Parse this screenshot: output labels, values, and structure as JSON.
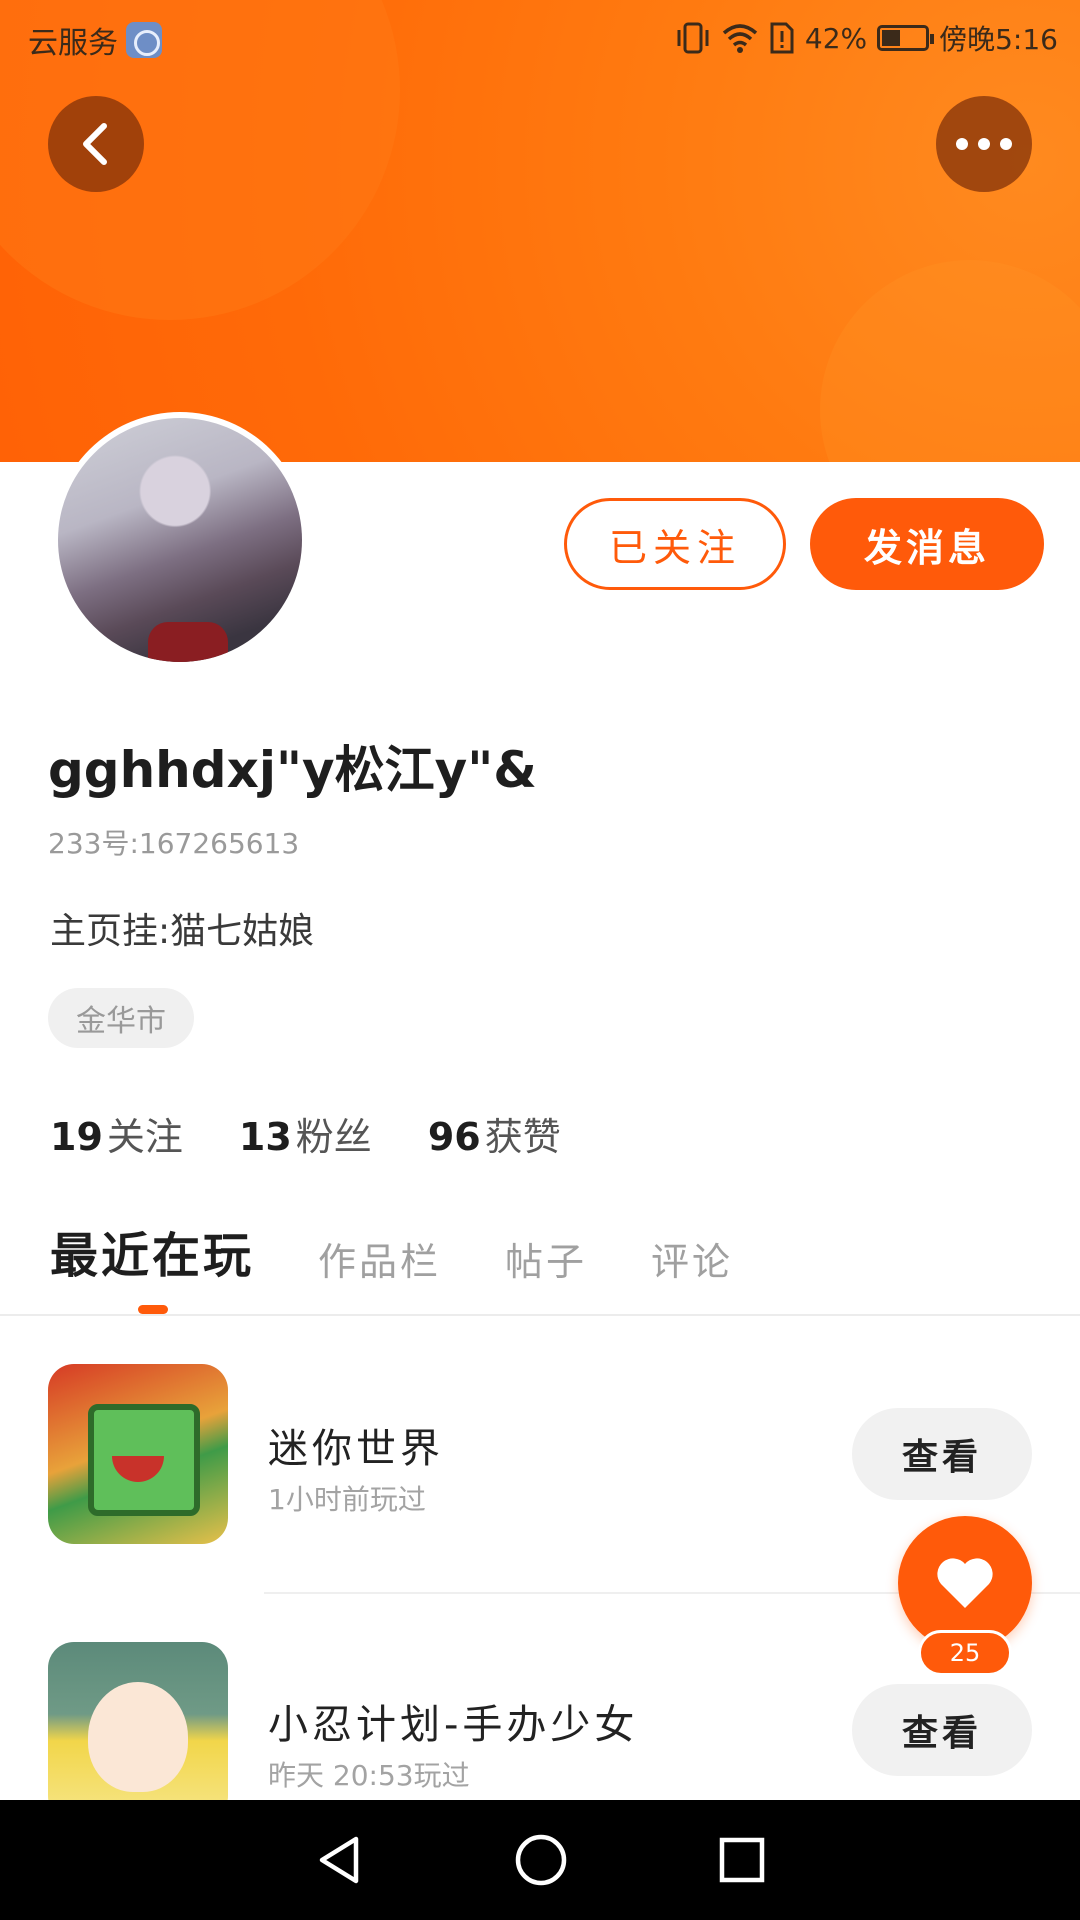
{
  "status_bar": {
    "left_text": "云服务",
    "battery_pct": "42%",
    "time": "傍晚5:16"
  },
  "profile": {
    "username": "gghhdxj\"y松江y\"&",
    "uid": "233号:167265613",
    "bio": "主页挂:猫七姑娘",
    "location_tag": "金华市",
    "follow_button": "已关注",
    "message_button": "发消息"
  },
  "stats": [
    {
      "value": "19",
      "label": "关注"
    },
    {
      "value": "13",
      "label": "粉丝"
    },
    {
      "value": "96",
      "label": "获赞"
    }
  ],
  "tabs": [
    {
      "label": "最近在玩",
      "active": true
    },
    {
      "label": "作品栏",
      "active": false
    },
    {
      "label": "帖子",
      "active": false
    },
    {
      "label": "评论",
      "active": false
    }
  ],
  "games": [
    {
      "title": "迷你世界",
      "subtitle": "1小时前玩过",
      "action": "查看"
    },
    {
      "title": "小忍计划-手办少女",
      "subtitle": "昨天 20:53玩过",
      "action": "查看"
    }
  ],
  "like_count": "25",
  "colors": {
    "accent": "#ff5a0a",
    "header": "#ff7010"
  }
}
